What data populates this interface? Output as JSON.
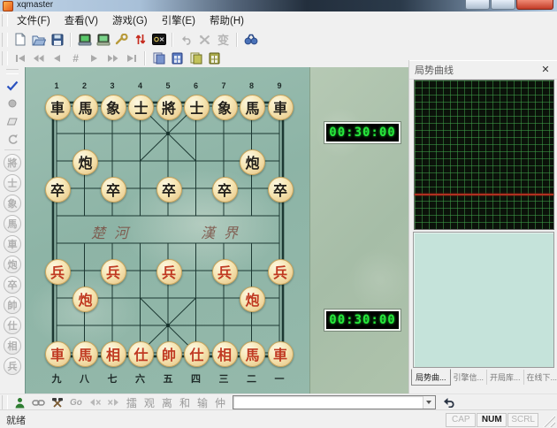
{
  "window": {
    "title": "xqmaster"
  },
  "menubar": {
    "items": [
      {
        "label": "文件(F)"
      },
      {
        "label": "查看(V)"
      },
      {
        "label": "游戏(G)"
      },
      {
        "label": "引擎(E)"
      },
      {
        "label": "帮助(H)"
      }
    ]
  },
  "toolbar1": {
    "icons": [
      "new-file-icon",
      "open-file-icon",
      "save-file-icon",
      "board-device-icon",
      "board-device-alt-icon",
      "wrench-icon",
      "flip-updown-icon",
      "engine-badge-icon",
      "undo-icon",
      "swap-icon",
      "change-glyph",
      "search-binoculars-icon"
    ],
    "change_glyph": "变"
  },
  "playback": {
    "move_number_glyph": "#",
    "buttons": [
      "first-move",
      "fast-back",
      "back",
      "move-number",
      "forward",
      "fast-forward",
      "last-move"
    ],
    "clipboard_icons": [
      "copy-moves-icon",
      "copy-position-icon",
      "paste-moves-icon",
      "paste-position-icon"
    ]
  },
  "sidebar": {
    "tools": [
      "check-icon",
      "dot-icon",
      "eraser-icon",
      "rotate-icon"
    ],
    "pieces": [
      "將",
      "士",
      "象",
      "馬",
      "車",
      "炮",
      "卒",
      "帥",
      "仕",
      "相",
      "兵"
    ]
  },
  "board": {
    "top_numbers": [
      "1",
      "2",
      "3",
      "4",
      "5",
      "6",
      "7",
      "8",
      "9"
    ],
    "bottom_numbers": [
      "九",
      "八",
      "七",
      "六",
      "五",
      "四",
      "三",
      "二",
      "一"
    ],
    "river_left": "楚河",
    "river_right": "漢界",
    "pieces": [
      {
        "r": 0,
        "c": 0,
        "t": "車",
        "s": "b"
      },
      {
        "r": 0,
        "c": 1,
        "t": "馬",
        "s": "b"
      },
      {
        "r": 0,
        "c": 2,
        "t": "象",
        "s": "b"
      },
      {
        "r": 0,
        "c": 3,
        "t": "士",
        "s": "b"
      },
      {
        "r": 0,
        "c": 4,
        "t": "將",
        "s": "b"
      },
      {
        "r": 0,
        "c": 5,
        "t": "士",
        "s": "b"
      },
      {
        "r": 0,
        "c": 6,
        "t": "象",
        "s": "b"
      },
      {
        "r": 0,
        "c": 7,
        "t": "馬",
        "s": "b"
      },
      {
        "r": 0,
        "c": 8,
        "t": "車",
        "s": "b"
      },
      {
        "r": 2,
        "c": 1,
        "t": "炮",
        "s": "b"
      },
      {
        "r": 2,
        "c": 7,
        "t": "炮",
        "s": "b"
      },
      {
        "r": 3,
        "c": 0,
        "t": "卒",
        "s": "b"
      },
      {
        "r": 3,
        "c": 2,
        "t": "卒",
        "s": "b"
      },
      {
        "r": 3,
        "c": 4,
        "t": "卒",
        "s": "b"
      },
      {
        "r": 3,
        "c": 6,
        "t": "卒",
        "s": "b"
      },
      {
        "r": 3,
        "c": 8,
        "t": "卒",
        "s": "b"
      },
      {
        "r": 6,
        "c": 0,
        "t": "兵",
        "s": "r"
      },
      {
        "r": 6,
        "c": 2,
        "t": "兵",
        "s": "r"
      },
      {
        "r": 6,
        "c": 4,
        "t": "兵",
        "s": "r"
      },
      {
        "r": 6,
        "c": 6,
        "t": "兵",
        "s": "r"
      },
      {
        "r": 6,
        "c": 8,
        "t": "兵",
        "s": "r"
      },
      {
        "r": 7,
        "c": 1,
        "t": "炮",
        "s": "r"
      },
      {
        "r": 7,
        "c": 7,
        "t": "炮",
        "s": "r"
      },
      {
        "r": 9,
        "c": 0,
        "t": "車",
        "s": "r"
      },
      {
        "r": 9,
        "c": 1,
        "t": "馬",
        "s": "r"
      },
      {
        "r": 9,
        "c": 2,
        "t": "相",
        "s": "r"
      },
      {
        "r": 9,
        "c": 3,
        "t": "仕",
        "s": "r"
      },
      {
        "r": 9,
        "c": 4,
        "t": "帥",
        "s": "r"
      },
      {
        "r": 9,
        "c": 5,
        "t": "仕",
        "s": "r"
      },
      {
        "r": 9,
        "c": 6,
        "t": "相",
        "s": "r"
      },
      {
        "r": 9,
        "c": 7,
        "t": "馬",
        "s": "r"
      },
      {
        "r": 9,
        "c": 8,
        "t": "車",
        "s": "r"
      }
    ]
  },
  "clocks": {
    "black": "00:30:00",
    "red": "00:30:00"
  },
  "right_panel": {
    "title": "局势曲线",
    "close_glyph": "✕",
    "chart": {
      "red_line_pct": 76
    },
    "tabs": [
      {
        "label": "局势曲...",
        "active": true
      },
      {
        "label": "引擎信...",
        "active": false
      },
      {
        "label": "开局库...",
        "active": false
      },
      {
        "label": "在线下...",
        "active": false
      }
    ]
  },
  "bottom_toolbar": {
    "icons": [
      "player-icon",
      "link-icon",
      "hammers-icon",
      "mute-left-icon",
      "mute-right-icon",
      "undo-back-icon"
    ],
    "go_label": "Go",
    "labels": [
      "擂",
      "观",
      "离",
      "和",
      "输",
      "仲"
    ],
    "combo_value": ""
  },
  "statusbar": {
    "ready": "就绪",
    "indicators": [
      {
        "label": "CAP",
        "active": false
      },
      {
        "label": "NUM",
        "active": true
      },
      {
        "label": "SCRL",
        "active": false
      }
    ]
  },
  "colors": {
    "board_teal": "#8db4a6",
    "panel_sage": "#aabfa8",
    "piece_red": "#c03a22",
    "piece_black": "#221f1a",
    "clock_green": "#27e83c",
    "chart_grid_green": "#3e9e48",
    "chart_line_red": "#b03020",
    "close_button_red": "#c33c28"
  }
}
